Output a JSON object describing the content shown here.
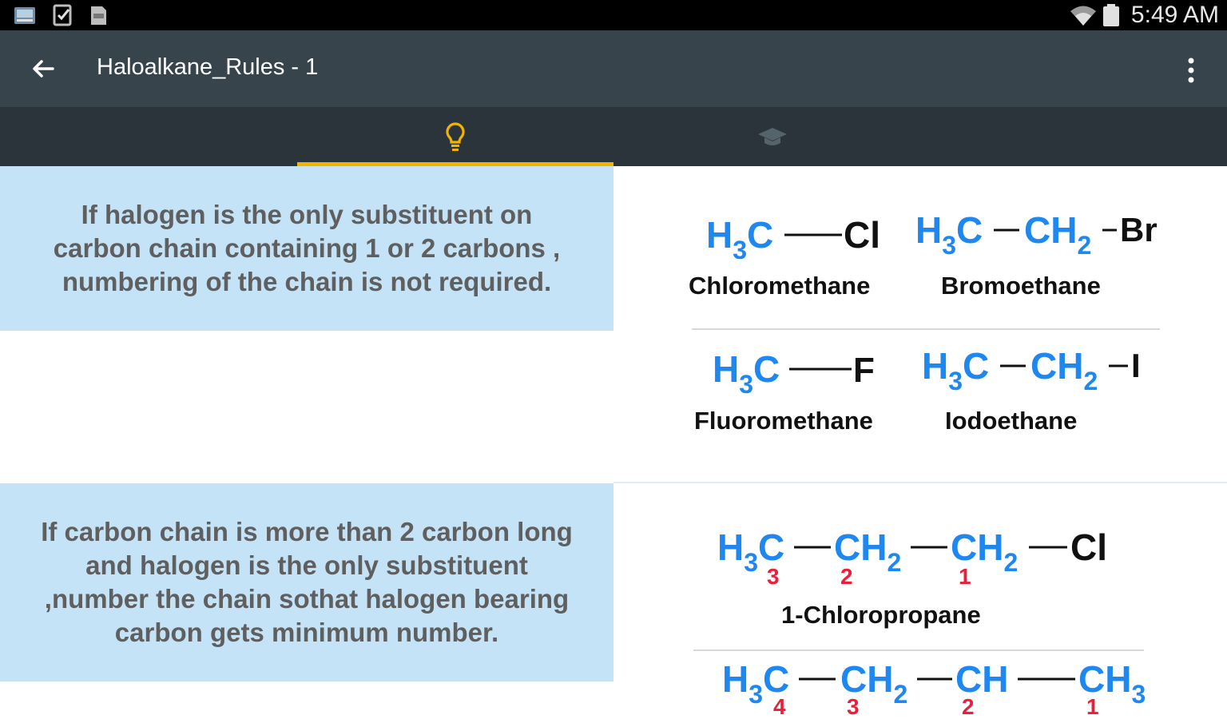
{
  "status_bar": {
    "time": "5:49 AM",
    "icons": [
      "gallery-icon",
      "tasks-icon",
      "sd-card-icon",
      "wifi-icon",
      "battery-icon"
    ]
  },
  "app_bar": {
    "title": "Haloalkane_Rules - 1",
    "back_icon": "arrow-left-icon",
    "menu_icon": "more-vert-icon"
  },
  "tabs": [
    {
      "icon": "lightbulb-icon",
      "selected": true
    },
    {
      "icon": "graduation-cap-icon",
      "selected": false
    }
  ],
  "colors": {
    "status_bar": "#000000",
    "app_bar": "#37444c",
    "tab_bar": "#2b343a",
    "accent": "#f3b400",
    "rule_background": "#c4e3f7",
    "formula_blue": "#1e88f0",
    "locant_red": "#e8203a"
  },
  "rules": [
    {
      "lines": [
        "If halogen is the only substituent on",
        "carbon chain containing 1 or 2 carbons ,",
        "numbering of the chain is not required."
      ]
    },
    {
      "lines": [
        "If carbon chain is more than 2 carbon long",
        "and halogen is the only substituent",
        ",number the chain sothat halogen bearing",
        "carbon gets minimum number."
      ]
    }
  ],
  "examples": {
    "chloromethane": {
      "name": "Chloromethane",
      "c1": "H",
      "c1sub": "3",
      "c1b": "C",
      "x": "Cl"
    },
    "bromoethane": {
      "name": "Bromoethane",
      "c1": "H",
      "c1sub": "3",
      "c1b": "C",
      "c2": "CH",
      "c2sub": "2",
      "x": "Br"
    },
    "fluoromethane": {
      "name": "Fluoromethane",
      "c1": "H",
      "c1sub": "3",
      "c1b": "C",
      "x": "F"
    },
    "iodoethane": {
      "name": "Iodoethane",
      "c1": "H",
      "c1sub": "3",
      "c1b": "C",
      "c2": "CH",
      "c2sub": "2",
      "x": "I"
    },
    "chloropropane": {
      "name": "1-Chloropropane",
      "c1": "H",
      "c1sub": "3",
      "c1b": "C",
      "c2": "CH",
      "c2sub": "2",
      "c3": "CH",
      "c3sub": "2",
      "x": "Cl",
      "locants": [
        "3",
        "2",
        "1"
      ]
    },
    "butane_chain": {
      "c1": "H",
      "c1sub": "3",
      "c1b": "C",
      "c2": "CH",
      "c2sub": "2",
      "c3": "CH",
      "c4": "CH",
      "c4sub": "3",
      "locants": [
        "4",
        "3",
        "2",
        "1"
      ]
    }
  }
}
